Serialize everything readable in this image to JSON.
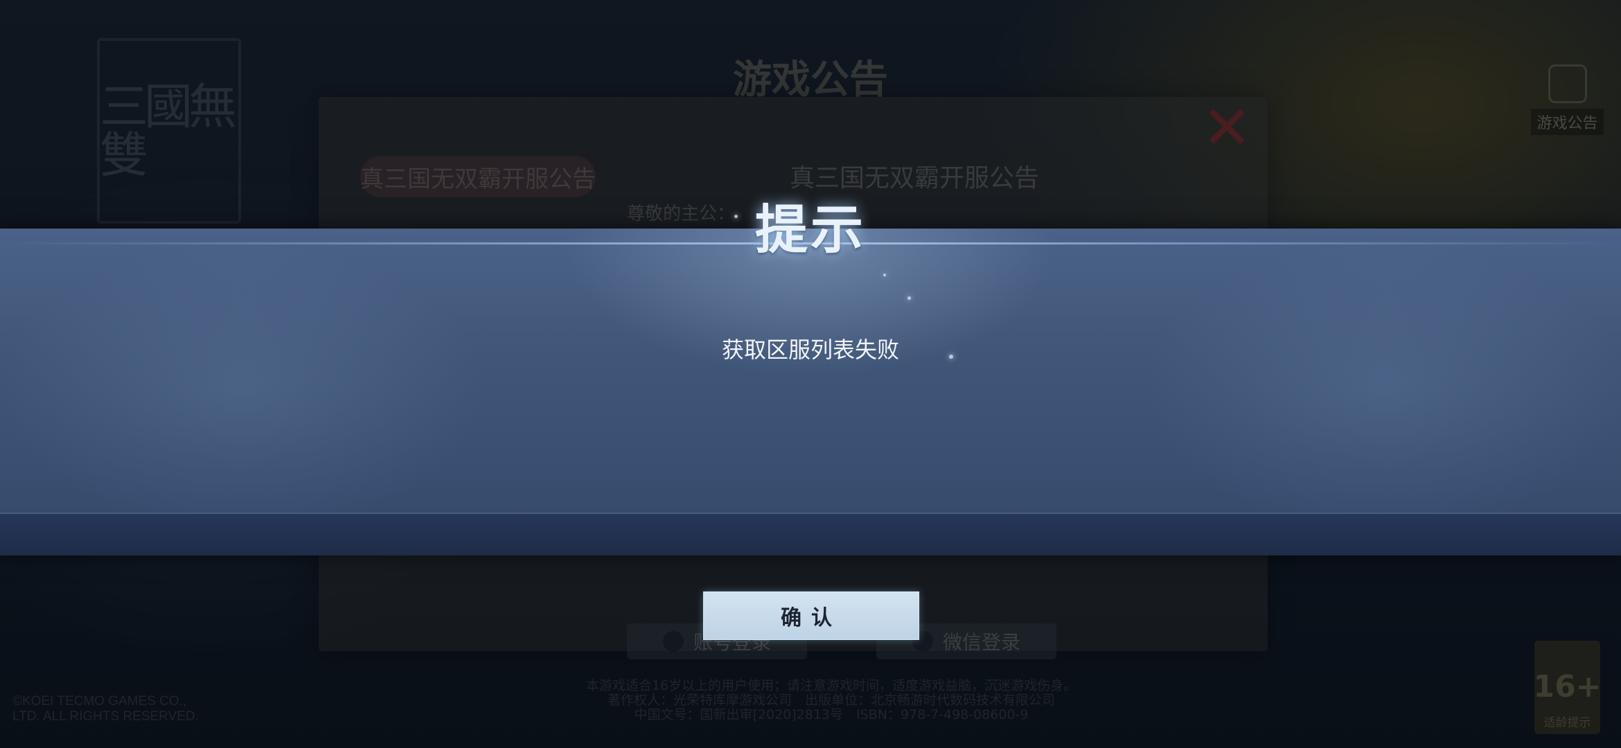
{
  "background": {
    "logo_text": "三國無雙",
    "notice_heading": "游戏公告",
    "notice_tab": "真三国无双霸开服公告",
    "notice_subtitle": "真三国无双霸开服公告",
    "notice_greeting": "尊敬的主公：",
    "announcement_button_label": "游戏公告",
    "login_button_left": "账号登录",
    "login_button_right": "微信登录",
    "age_badge_number": "16+",
    "age_badge_label": "适龄提示",
    "copyright_lines": [
      "©KOEI TECMO GAMES CO.,",
      "LTD. ALL RIGHTS RESERVED."
    ],
    "footer_lines": [
      "本游戏适合16岁以上的用户使用；请注意游戏时间，适度游戏益脑，沉迷游戏伤身。",
      "著作权人：光荣特库摩游戏公司　出版单位：北京畅游时代数码技术有限公司",
      "中国文号：国新出审[2020]2813号　ISBN：978-7-498-08600-9"
    ]
  },
  "dialog": {
    "title": "提示",
    "message": "获取区服列表失败",
    "confirm_label": "确认"
  },
  "colors": {
    "band_primary": "#405678",
    "band_bottom": "#1e2c47",
    "button_bg": "#c6d9ea",
    "close_red": "#aa282d"
  }
}
